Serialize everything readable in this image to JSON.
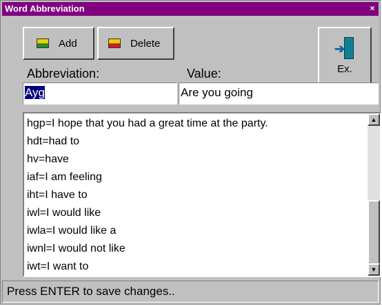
{
  "window": {
    "title": "Word Abbreviation",
    "close_glyph": "×"
  },
  "toolbar": {
    "add_label": "Add",
    "delete_label": "Delete",
    "exit_label": "Ex."
  },
  "form": {
    "abbreviation_label": "Abbreviation:",
    "value_label": "Value:",
    "abbreviation_value": "Ayg",
    "value_value": "Are you going"
  },
  "list": {
    "items": [
      "hgp=I hope that you had a great time at the party.",
      "hdt=had to",
      "hv=have",
      "iaf=I am feeling",
      "iht=I have to",
      "iwl=I would like",
      "iwla=I would like a",
      "iwnl=I would not like",
      "iwt=I want to"
    ]
  },
  "status": {
    "text": "Press ENTER to save changes.."
  }
}
